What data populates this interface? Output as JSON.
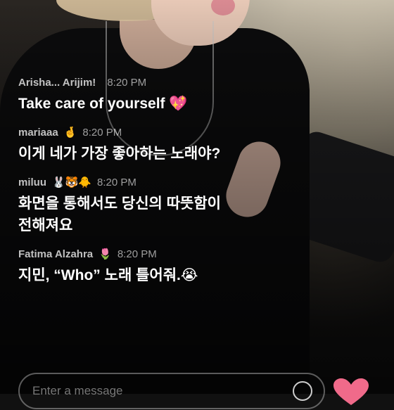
{
  "messages": [
    {
      "user": "Arisha... Arijim!",
      "user_emoji": "",
      "time": "8:20 PM",
      "text": "Take care of yourself 💖"
    },
    {
      "user": "mariaaa",
      "user_emoji": "🤞",
      "time": "8:20 PM",
      "text": "이게 네가 가장 좋아하는 노래야?"
    },
    {
      "user": "miluu",
      "user_emoji": "🐰🐯🐥",
      "time": "8:20 PM",
      "text": "화면을 통해서도 당신의 따뜻함이\n전해져요"
    },
    {
      "user": "Fatima Alzahra",
      "user_emoji": "🌷",
      "time": "8:20 PM",
      "text": "지민, “Who” 노래 틀어줘.😭"
    }
  ],
  "composer": {
    "placeholder": "Enter a message"
  },
  "icons": {
    "send": "refresh-send-icon",
    "like": "heart-icon"
  },
  "colors": {
    "heart": "#f06a8a",
    "text": "#ffffff"
  }
}
